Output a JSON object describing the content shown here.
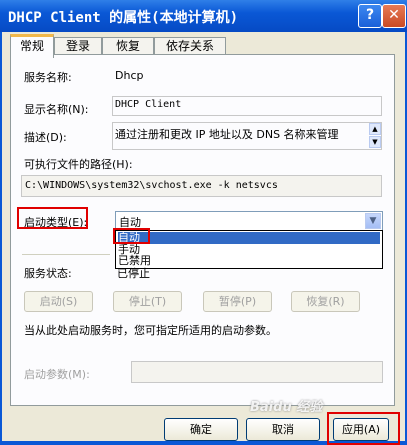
{
  "window": {
    "title": "DHCP Client 的属性(本地计算机)",
    "help_glyph": "?",
    "close_glyph": "✕"
  },
  "tabs": [
    "常规",
    "登录",
    "恢复",
    "依存关系"
  ],
  "general": {
    "service_name_label": "服务名称:",
    "service_name": "Dhcp",
    "display_name_label": "显示名称(N):",
    "display_name": "DHCP Client",
    "description_label": "描述(D):",
    "description": "通过注册和更改 IP 地址以及 DNS 名称来管理",
    "path_label": "可执行文件的路径(H):",
    "path": "C:\\WINDOWS\\system32\\svchost.exe -k netsvcs",
    "startup_type_label": "启动类型(E):",
    "startup_type_value": "自动",
    "startup_options": [
      "自动",
      "手动",
      "已禁用"
    ],
    "service_status_label": "服务状态:",
    "service_status": "已停止",
    "buttons": [
      "启动(S)",
      "停止(T)",
      "暂停(P)",
      "恢复(R)"
    ],
    "hint": "当从此处启动服务时，您可指定所适用的启动参数。",
    "start_params_label": "启动参数(M):"
  },
  "dialog_buttons": {
    "ok": "确定",
    "cancel": "取消",
    "apply": "应用(A)"
  },
  "highlight_color": "#e00000",
  "selection_color": "#316ac5"
}
